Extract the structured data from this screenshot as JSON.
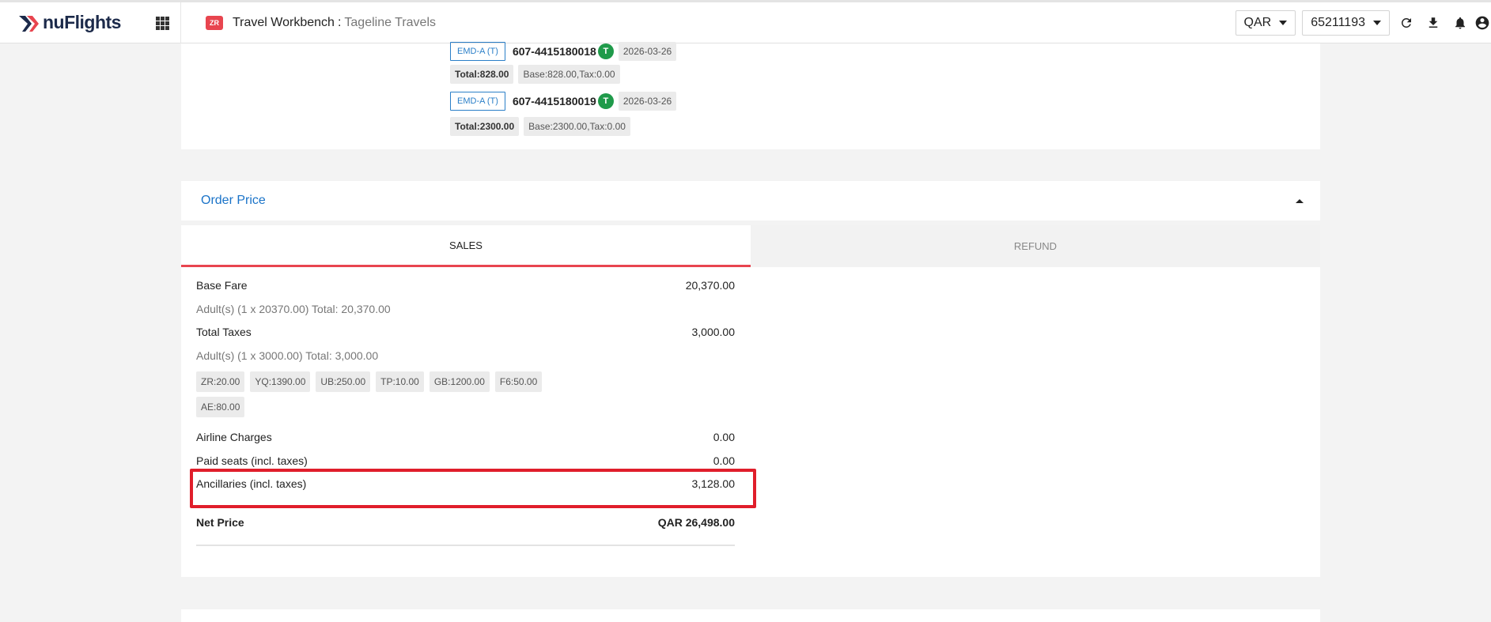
{
  "header": {
    "logo_text": "nuFlights",
    "badge": "ZR",
    "title": "Travel Workbench",
    "separator": ":",
    "subtitle": "Tageline Travels",
    "currency": "QAR",
    "account": "65211193",
    "icons": [
      "apps-grid-icon",
      "refresh-icon",
      "download-icon",
      "bell-icon",
      "user-icon"
    ]
  },
  "emds": [
    {
      "tag": "EMD-A (T)",
      "number": "607-4415180018",
      "status": "T",
      "date": "2026-03-26",
      "total": "Total:828.00",
      "breakdown": "Base:828.00,Tax:0.00"
    },
    {
      "tag": "EMD-A (T)",
      "number": "607-4415180019",
      "status": "T",
      "date": "2026-03-26",
      "total": "Total:2300.00",
      "breakdown": "Base:2300.00,Tax:0.00"
    }
  ],
  "order_price": {
    "title": "Order Price",
    "tabs": [
      {
        "label": "SALES",
        "active": true
      },
      {
        "label": "REFUND",
        "active": false
      }
    ],
    "base_fare": {
      "label": "Base Fare",
      "value": "20,370.00",
      "detail": "Adult(s) (1 x 20370.00) Total: 20,370.00"
    },
    "total_taxes": {
      "label": "Total Taxes",
      "value": "3,000.00",
      "detail": "Adult(s) (1 x 3000.00) Total: 3,000.00"
    },
    "tax_codes": [
      "ZR:20.00",
      "YQ:1390.00",
      "UB:250.00",
      "TP:10.00",
      "GB:1200.00",
      "F6:50.00",
      "AE:80.00"
    ],
    "airline_charges": {
      "label": "Airline Charges",
      "value": "0.00"
    },
    "paid_seats": {
      "label": "Paid seats (incl. taxes)",
      "value": "0.00"
    },
    "ancillaries": {
      "label": "Ancillaries (incl. taxes)",
      "value": "3,128.00"
    },
    "net_price": {
      "label": "Net Price",
      "value": "QAR 26,498.00"
    }
  },
  "colors": {
    "accent_red": "#e8454f",
    "highlight_red": "#e01e2b",
    "link_blue": "#1a73c8",
    "status_green": "#1f9a4a"
  }
}
